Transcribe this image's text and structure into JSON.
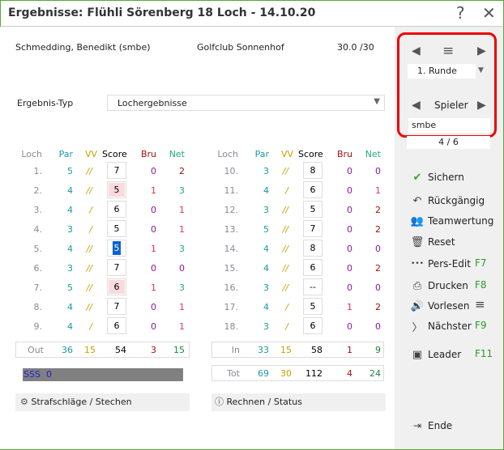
{
  "title": "Ergebnisse: Flühli Sörenberg 18 Loch - 14.10.20",
  "help_label": "?",
  "close_label": "✕",
  "player": {
    "name": "Schmedding, Benedikt (smbe)",
    "club": "Golfclub Sonnenhof",
    "hcp": "30.0 /30"
  },
  "ergebnis_typ": {
    "label": "Ergebnis-Typ",
    "value": "Lochergebnisse"
  },
  "headers": {
    "loch": "Loch",
    "par": "Par",
    "vv": "VV",
    "score": "Score",
    "bru": "Bru",
    "net": "Net"
  },
  "front": [
    {
      "loch": "1.",
      "par": "5",
      "vv": "//",
      "score": "7",
      "bru": "0",
      "net": "2",
      "pink": false
    },
    {
      "loch": "2.",
      "par": "4",
      "vv": "//",
      "score": "5",
      "bru": "1",
      "net": "3",
      "pink": true
    },
    {
      "loch": "3.",
      "par": "4",
      "vv": "/",
      "score": "6",
      "bru": "0",
      "net": "1",
      "pink": false
    },
    {
      "loch": "4.",
      "par": "3",
      "vv": "/",
      "score": "5",
      "bru": "0",
      "net": "1",
      "pink": false
    },
    {
      "loch": "5.",
      "par": "4",
      "vv": "//",
      "score": "5",
      "bru": "1",
      "net": "3",
      "pink": true,
      "selected": true
    },
    {
      "loch": "6.",
      "par": "3",
      "vv": "//",
      "score": "7",
      "bru": "0",
      "net": "0",
      "pink": false
    },
    {
      "loch": "7.",
      "par": "5",
      "vv": "//",
      "score": "6",
      "bru": "1",
      "net": "3",
      "pink": true
    },
    {
      "loch": "8.",
      "par": "4",
      "vv": "//",
      "score": "7",
      "bru": "0",
      "net": "1",
      "pink": false
    },
    {
      "loch": "9.",
      "par": "4",
      "vv": "/",
      "score": "6",
      "bru": "0",
      "net": "1",
      "pink": false
    }
  ],
  "back": [
    {
      "loch": "10.",
      "par": "3",
      "vv": "//",
      "score": "8",
      "bru": "0",
      "net": "0"
    },
    {
      "loch": "11.",
      "par": "4",
      "vv": "/",
      "score": "6",
      "bru": "0",
      "net": "1"
    },
    {
      "loch": "12.",
      "par": "3",
      "vv": "//",
      "score": "5",
      "bru": "0",
      "net": "2"
    },
    {
      "loch": "13.",
      "par": "5",
      "vv": "//",
      "score": "7",
      "bru": "0",
      "net": "2"
    },
    {
      "loch": "14.",
      "par": "4",
      "vv": "//",
      "score": "8",
      "bru": "0",
      "net": "0"
    },
    {
      "loch": "15.",
      "par": "4",
      "vv": "//",
      "score": "6",
      "bru": "0",
      "net": "2"
    },
    {
      "loch": "16.",
      "par": "3",
      "vv": "//",
      "score": "--",
      "bru": "0",
      "net": "0"
    },
    {
      "loch": "17.",
      "par": "4",
      "vv": "/",
      "score": "5",
      "bru": "1",
      "net": "2"
    },
    {
      "loch": "18.",
      "par": "3",
      "vv": "/",
      "score": "6",
      "bru": "0",
      "net": "0"
    }
  ],
  "out": {
    "loch": "Out",
    "par": "36",
    "vv": "15",
    "score": "54",
    "bru": "3",
    "net": "15"
  },
  "in": {
    "loch": "In",
    "par": "33",
    "vv": "15",
    "score": "58",
    "bru": "1",
    "net": "9"
  },
  "tot": {
    "loch": "Tot",
    "par": "69",
    "vv": "30",
    "score": "112",
    "bru": "4",
    "net": "24"
  },
  "sss": "SSS  0",
  "buttons": {
    "strafschlaege": "Strafschläge / Stechen",
    "rechnen": "Rechnen / Status"
  },
  "nav": {
    "runde": "1. Runde",
    "spieler": "Spieler",
    "spieler_value": "smbe",
    "count": "4 / 6"
  },
  "menu": [
    {
      "label": "Sichern",
      "icon": "check-icon",
      "glyph": "✔",
      "key": ""
    },
    {
      "label": "Rückgängig",
      "icon": "undo-icon",
      "glyph": "↶",
      "key": ""
    },
    {
      "label": "Teamwertung",
      "icon": "team-icon",
      "glyph": "👥",
      "key": ""
    },
    {
      "label": "Reset",
      "icon": "trash-icon",
      "glyph": "🗑",
      "key": ""
    },
    {
      "label": "Pers-Edit",
      "icon": "dots-icon",
      "glyph": "•••",
      "key": "F7"
    },
    {
      "label": "Drucken",
      "icon": "printer-icon",
      "glyph": "⎙",
      "key": "F8"
    },
    {
      "label": "Vorlesen",
      "icon": "speaker-icon",
      "glyph": "🔊",
      "key": "≡"
    },
    {
      "label": "Nächster",
      "icon": "chevron-right-icon",
      "glyph": "〉",
      "key": "F9"
    },
    {
      "label": "Leader",
      "icon": "image-icon",
      "glyph": "▣",
      "key": "F11"
    }
  ],
  "ende": "Ende",
  "colors": {
    "loch": "#8a8a9a",
    "par": "#1a9aa0",
    "vv": "#c8a000",
    "bru0": "#8b1a9b",
    "bru1": "#e0304a",
    "net0": "#8b1a9b",
    "net1": "#e8306a",
    "net2": "#a01010",
    "net3": "#20b070",
    "accent": "#5aa832"
  }
}
